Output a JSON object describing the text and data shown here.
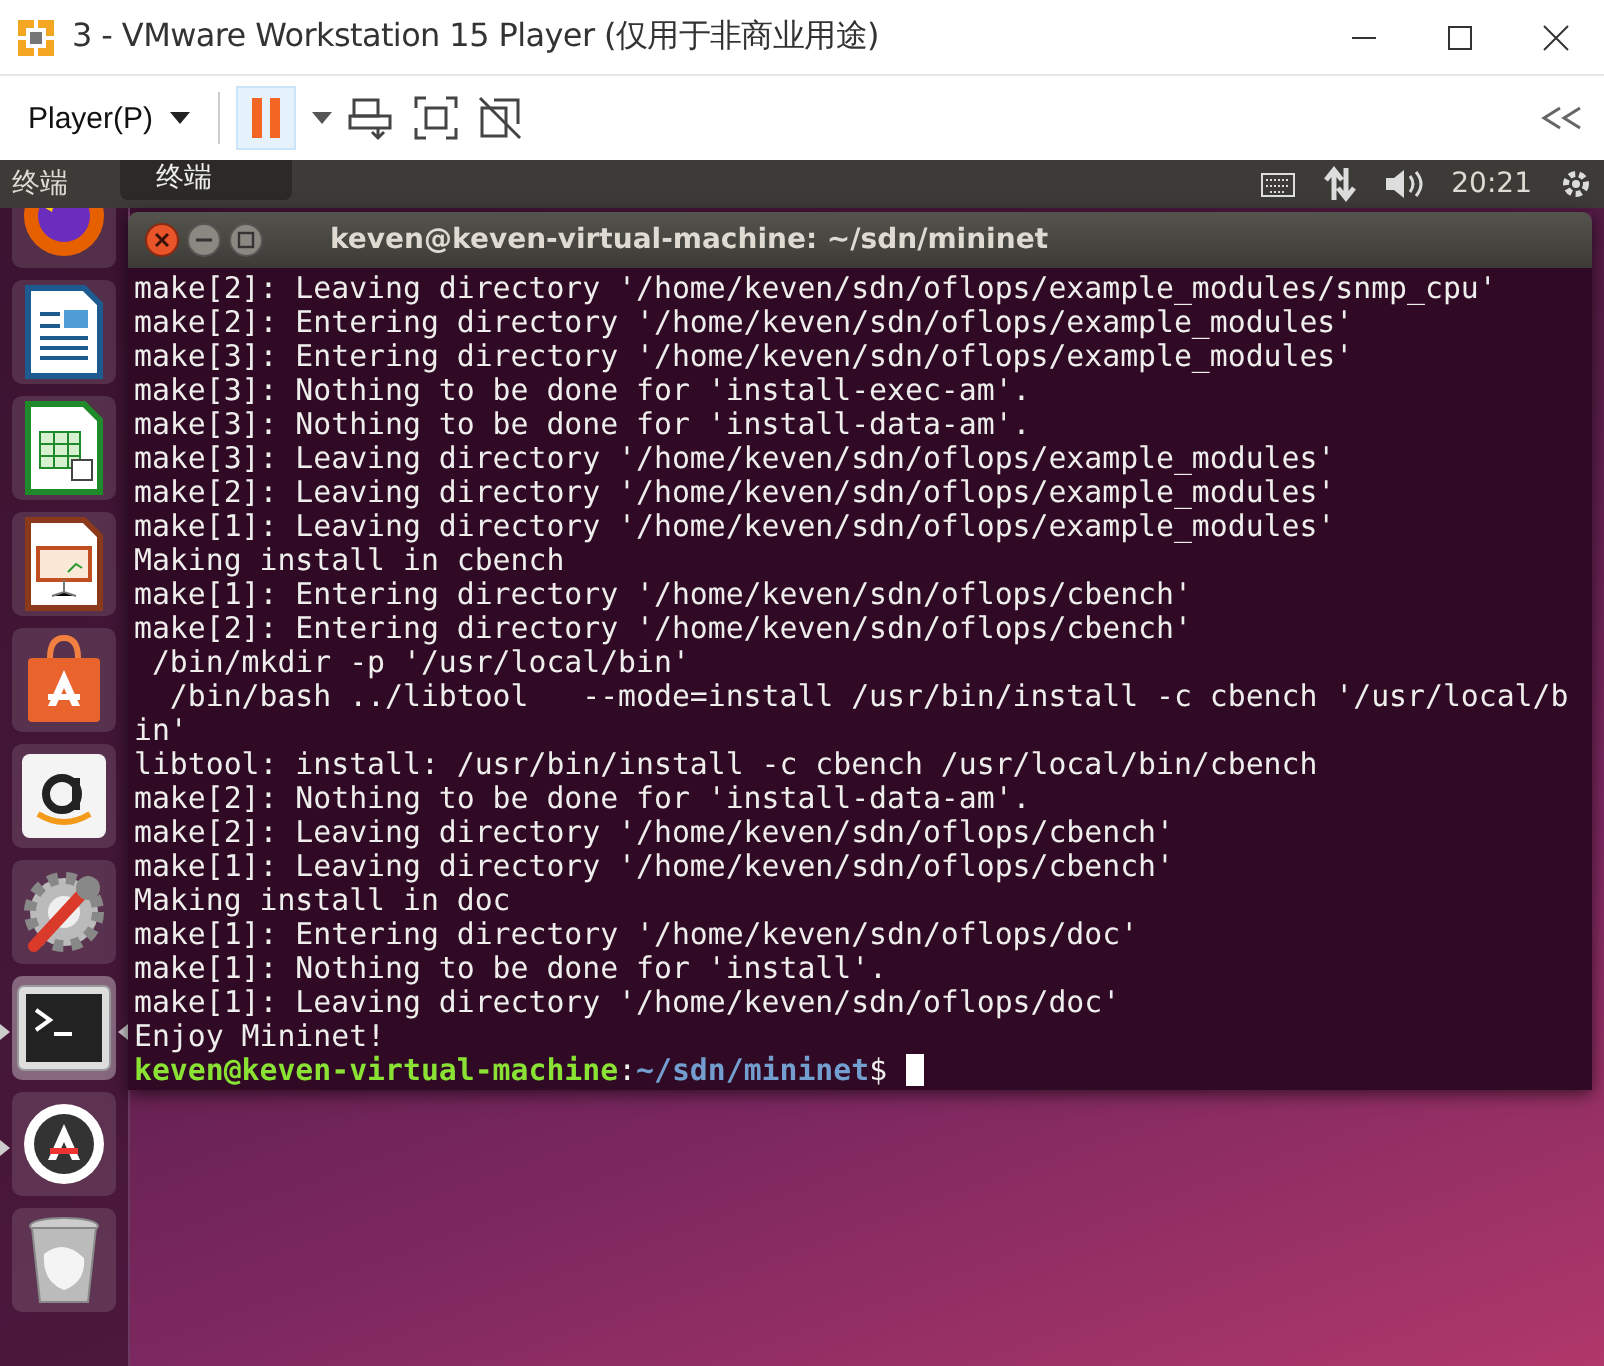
{
  "window": {
    "title": "3 - VMware Workstation 15 Player (仅用于非商业用途)"
  },
  "toolbar": {
    "player_menu": "Player(P)",
    "pause_pressed": true
  },
  "guest": {
    "panel": {
      "app_title": "终端",
      "time": "20:21"
    },
    "tooltip": "终端",
    "launcher": [
      {
        "kind": "browser",
        "running": false,
        "focused": false
      },
      {
        "kind": "writer",
        "running": false,
        "focused": false
      },
      {
        "kind": "calc",
        "running": false,
        "focused": false
      },
      {
        "kind": "impress",
        "running": false,
        "focused": false
      },
      {
        "kind": "software",
        "running": false,
        "focused": false
      },
      {
        "kind": "amazon",
        "running": false,
        "focused": false
      },
      {
        "kind": "settings",
        "running": false,
        "focused": false
      },
      {
        "kind": "terminal",
        "running": true,
        "focused": true
      },
      {
        "kind": "updater",
        "running": true,
        "focused": false
      },
      {
        "kind": "trash",
        "running": false,
        "focused": false
      }
    ],
    "terminal": {
      "title": "keven@keven-virtual-machine: ~/sdn/mininet",
      "lines": [
        {
          "kind": "output",
          "text": "make[2]: Leaving directory '/home/keven/sdn/oflops/example_modules/snmp_cpu'"
        },
        {
          "kind": "output",
          "text": "make[2]: Entering directory '/home/keven/sdn/oflops/example_modules'"
        },
        {
          "kind": "output",
          "text": "make[3]: Entering directory '/home/keven/sdn/oflops/example_modules'"
        },
        {
          "kind": "output",
          "text": "make[3]: Nothing to be done for 'install-exec-am'."
        },
        {
          "kind": "output",
          "text": "make[3]: Nothing to be done for 'install-data-am'."
        },
        {
          "kind": "output",
          "text": "make[3]: Leaving directory '/home/keven/sdn/oflops/example_modules'"
        },
        {
          "kind": "output",
          "text": "make[2]: Leaving directory '/home/keven/sdn/oflops/example_modules'"
        },
        {
          "kind": "output",
          "text": "make[1]: Leaving directory '/home/keven/sdn/oflops/example_modules'"
        },
        {
          "kind": "output",
          "text": "Making install in cbench"
        },
        {
          "kind": "output",
          "text": "make[1]: Entering directory '/home/keven/sdn/oflops/cbench'"
        },
        {
          "kind": "output",
          "text": "make[2]: Entering directory '/home/keven/sdn/oflops/cbench'"
        },
        {
          "kind": "output",
          "text": " /bin/mkdir -p '/usr/local/bin'"
        },
        {
          "kind": "output",
          "text": "  /bin/bash ../libtool   --mode=install /usr/bin/install -c cbench '/usr/local/b"
        },
        {
          "kind": "output",
          "text": "in'"
        },
        {
          "kind": "output",
          "text": "libtool: install: /usr/bin/install -c cbench /usr/local/bin/cbench"
        },
        {
          "kind": "output",
          "text": "make[2]: Nothing to be done for 'install-data-am'."
        },
        {
          "kind": "output",
          "text": "make[2]: Leaving directory '/home/keven/sdn/oflops/cbench'"
        },
        {
          "kind": "output",
          "text": "make[1]: Leaving directory '/home/keven/sdn/oflops/cbench'"
        },
        {
          "kind": "output",
          "text": "Making install in doc"
        },
        {
          "kind": "output",
          "text": "make[1]: Entering directory '/home/keven/sdn/oflops/doc'"
        },
        {
          "kind": "output",
          "text": "make[1]: Nothing to be done for 'install'."
        },
        {
          "kind": "output",
          "text": "make[1]: Leaving directory '/home/keven/sdn/oflops/doc'"
        },
        {
          "kind": "output",
          "text": "Enjoy Mininet!"
        },
        {
          "kind": "prompt",
          "user": "keven@keven-virtual-machine",
          "separator": ":",
          "path": "~/sdn/mininet",
          "symbol": "$"
        }
      ]
    }
  }
}
